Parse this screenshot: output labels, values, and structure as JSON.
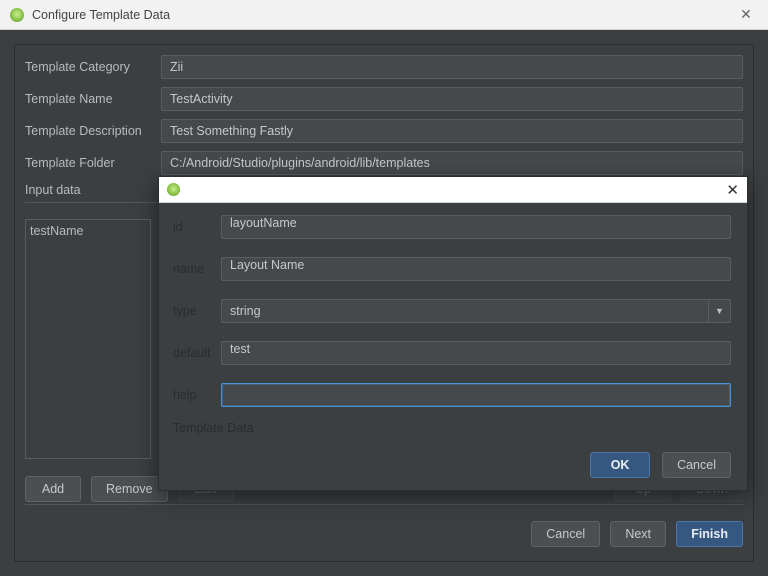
{
  "outer": {
    "title": "Configure Template Data",
    "labels": {
      "category": "Template Category",
      "name": "Template Name",
      "description": "Template Description",
      "folder": "Template Folder",
      "input_data": "Input data"
    },
    "values": {
      "category": "Zii",
      "name": "TestActivity",
      "description": "Test Something Fastly",
      "folder": "C:/Android/Studio/plugins/android/lib/templates"
    },
    "list_items": [
      "testName"
    ],
    "buttons": {
      "add": "Add",
      "remove": "Remove",
      "edit": "Edit",
      "up": "Up",
      "down": "Down",
      "cancel": "Cancel",
      "next": "Next",
      "finish": "Finish"
    }
  },
  "inner": {
    "fields": {
      "id_label": "id",
      "id_value": "layoutName",
      "name_label": "name",
      "name_value": "Layout Name",
      "type_label": "type",
      "type_value": "string",
      "default_label": "default",
      "default_value": "test",
      "help_label": "help",
      "help_value": ""
    },
    "template_data_label": "Template Data",
    "buttons": {
      "ok": "OK",
      "cancel": "Cancel"
    }
  }
}
